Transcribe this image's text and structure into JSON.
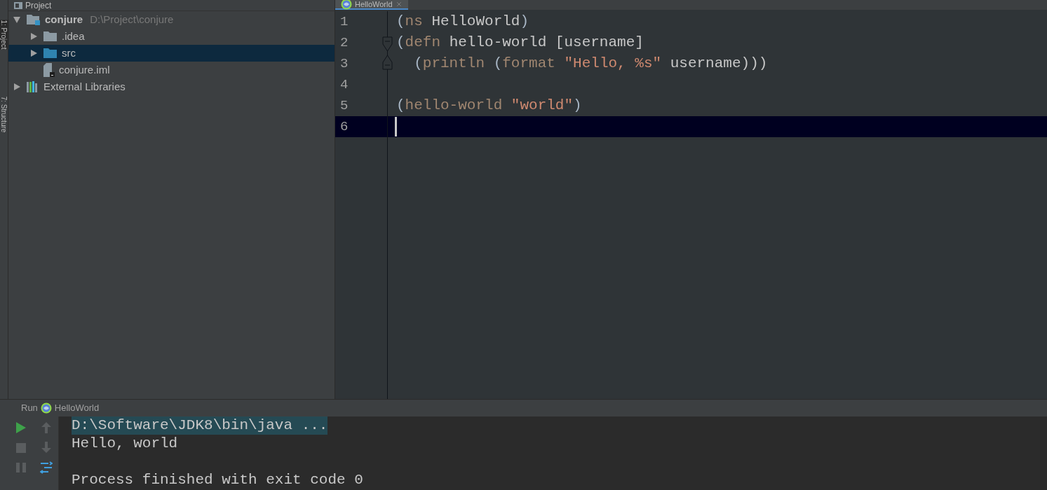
{
  "tool_strip": [
    "1: Project",
    "7: Structure"
  ],
  "project_panel": {
    "title": "Project",
    "tree": [
      {
        "label": "conjure",
        "path": "D:\\Project\\conjure",
        "kind": "module",
        "expanded": true,
        "selected": false,
        "children": [
          {
            "label": ".idea",
            "kind": "folder",
            "expanded": false,
            "selected": false
          },
          {
            "label": "src",
            "kind": "source-folder",
            "expanded": false,
            "selected": true
          },
          {
            "label": "conjure.iml",
            "kind": "file",
            "selected": false
          }
        ]
      },
      {
        "label": "External Libraries",
        "kind": "library",
        "expanded": false,
        "selected": false
      }
    ]
  },
  "editor": {
    "tabs": [
      {
        "label": "HelloWorld",
        "selected": true
      }
    ],
    "lines": [
      {
        "number": "1",
        "kind": "plain",
        "current": false,
        "tokens": [
          {
            "text": "(",
            "kind": "paren"
          },
          {
            "text": "ns",
            "kind": "keyword"
          },
          {
            "text": " HelloWorld",
            "kind": "symbol"
          },
          {
            "text": ")",
            "kind": "paren"
          }
        ]
      },
      {
        "number": "2",
        "kind": "fold-start",
        "current": false,
        "tokens": [
          {
            "text": "(",
            "kind": "paren"
          },
          {
            "text": "defn",
            "kind": "keyword"
          },
          {
            "text": " hello-world [username]",
            "kind": "symbol"
          }
        ]
      },
      {
        "number": "3",
        "kind": "fold-end",
        "current": false,
        "tokens": [
          {
            "text": "  (",
            "kind": "paren"
          },
          {
            "text": "println",
            "kind": "keyword"
          },
          {
            "text": " (",
            "kind": "paren"
          },
          {
            "text": "format",
            "kind": "keyword"
          },
          {
            "text": " \"Hello, %s\"",
            "kind": "string"
          },
          {
            "text": " username)))",
            "kind": "symbol"
          }
        ]
      },
      {
        "number": "4",
        "kind": "plain",
        "current": false
      },
      {
        "number": "5",
        "kind": "plain",
        "current": false,
        "tokens": [
          {
            "text": "(",
            "kind": "paren"
          },
          {
            "text": "hello-world",
            "kind": "keyword"
          },
          {
            "text": " \"world\"",
            "kind": "string"
          },
          {
            "text": ")",
            "kind": "paren"
          }
        ]
      },
      {
        "number": "6",
        "kind": "plain",
        "current": true
      }
    ]
  },
  "run_panel": {
    "label": "Run",
    "config": "HelloWorld",
    "console": [
      {
        "text": "D:\\Software\\JDK8\\bin\\java ...",
        "kind": "command"
      },
      {
        "text": "Hello, world",
        "kind": "output"
      },
      {
        "text": "Process finished with exit code 0",
        "kind": "output"
      }
    ]
  }
}
